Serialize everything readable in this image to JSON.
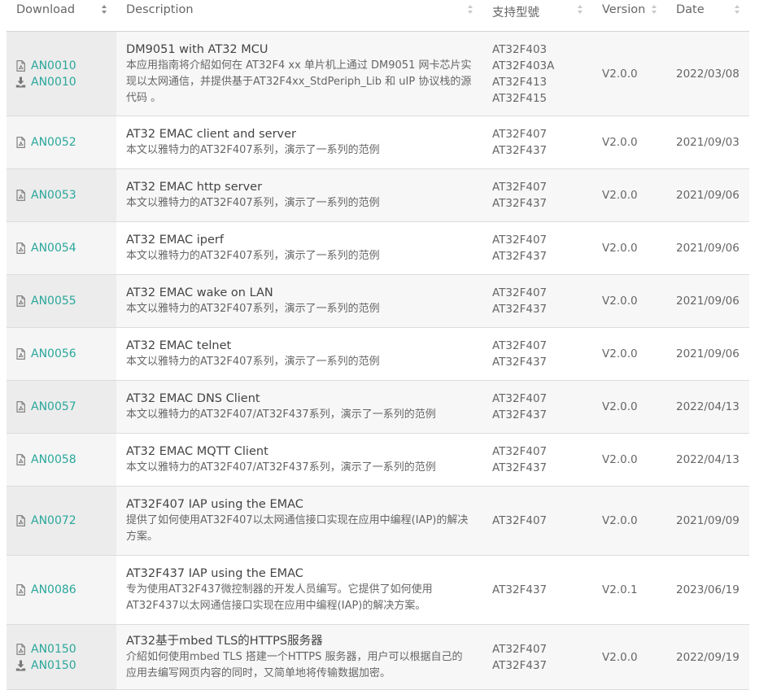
{
  "headers": {
    "download": "Download",
    "description": "Description",
    "models": "支持型號",
    "version": "Version",
    "date": "Date"
  },
  "rows": [
    {
      "downloads": [
        {
          "icon": "pdf-icon",
          "label": "AN0010"
        },
        {
          "icon": "download-icon",
          "label": "AN0010"
        }
      ],
      "title": "DM9051 with AT32 MCU",
      "desc": "本应用指南将介紹如何在 AT32F4 xx 单片机上通过 DM9051 网卡芯片实现以太网通信，并提供基于AT32F4xx_StdPeriph_Lib 和 uIP 协议栈的源代码 。",
      "models": [
        "AT32F403",
        "AT32F403A",
        "AT32F413",
        "AT32F415"
      ],
      "version": "V2.0.0",
      "date": "2022/03/08"
    },
    {
      "downloads": [
        {
          "icon": "pdf-icon",
          "label": "AN0052"
        }
      ],
      "title": "AT32 EMAC client and server",
      "desc": "本文以雅特力的AT32F407系列，演示了一系列的范例",
      "models": [
        "AT32F407",
        "AT32F437"
      ],
      "version": "V2.0.0",
      "date": "2021/09/03"
    },
    {
      "downloads": [
        {
          "icon": "pdf-icon",
          "label": "AN0053"
        }
      ],
      "title": "AT32 EMAC http server",
      "desc": "本文以雅特力的AT32F407系列，演示了一系列的范例",
      "models": [
        "AT32F407",
        "AT32F437"
      ],
      "version": "V2.0.0",
      "date": "2021/09/06"
    },
    {
      "downloads": [
        {
          "icon": "pdf-icon",
          "label": "AN0054"
        }
      ],
      "title": "AT32 EMAC iperf",
      "desc": "本文以雅特力的AT32F407系列，演示了一系列的范例",
      "models": [
        "AT32F407",
        "AT32F437"
      ],
      "version": "V2.0.0",
      "date": "2021/09/06"
    },
    {
      "downloads": [
        {
          "icon": "pdf-icon",
          "label": "AN0055"
        }
      ],
      "title": "AT32 EMAC wake on LAN",
      "desc": "本文以雅特力的AT32F407系列，演示了一系列的范例",
      "models": [
        "AT32F407",
        "AT32F437"
      ],
      "version": "V2.0.0",
      "date": "2021/09/06"
    },
    {
      "downloads": [
        {
          "icon": "pdf-icon",
          "label": "AN0056"
        }
      ],
      "title": "AT32 EMAC telnet",
      "desc": "本文以雅特力的AT32F407系列，演示了一系列的范例",
      "models": [
        "AT32F407",
        "AT32F437"
      ],
      "version": "V2.0.0",
      "date": "2021/09/06"
    },
    {
      "downloads": [
        {
          "icon": "pdf-icon",
          "label": "AN0057"
        }
      ],
      "title": "AT32 EMAC DNS Client",
      "desc": "本文以雅特力的AT32F407/AT32F437系列，演示了一系列的范例",
      "models": [
        "AT32F407",
        "AT32F437"
      ],
      "version": "V2.0.0",
      "date": "2022/04/13"
    },
    {
      "downloads": [
        {
          "icon": "pdf-icon",
          "label": "AN0058"
        }
      ],
      "title": "AT32 EMAC MQTT Client",
      "desc": "本文以雅特力的AT32F407/AT32F437系列，演示了一系列的范例",
      "models": [
        "AT32F407",
        "AT32F437"
      ],
      "version": "V2.0.0",
      "date": "2022/04/13"
    },
    {
      "downloads": [
        {
          "icon": "pdf-icon",
          "label": "AN0072"
        }
      ],
      "title": "AT32F407 IAP using the EMAC",
      "desc": "提供了如何使用AT32F407以太网通信接口实现在应用中编程(IAP)的解决方案。",
      "models": [
        "AT32F407"
      ],
      "version": "V2.0.0",
      "date": "2021/09/09"
    },
    {
      "downloads": [
        {
          "icon": "pdf-icon",
          "label": "AN0086"
        }
      ],
      "title": "AT32F437 IAP using the EMAC",
      "desc": "专为使用AT32F437微控制器的开发人员编写。它提供了如何使用AT32F437以太网通信接口实现在应用中编程(IAP)的解决方案。",
      "models": [
        "AT32F437"
      ],
      "version": "V2.0.1",
      "date": "2023/06/19"
    },
    {
      "downloads": [
        {
          "icon": "pdf-icon",
          "label": "AN0150"
        },
        {
          "icon": "download-icon",
          "label": "AN0150"
        }
      ],
      "title": "AT32基于mbed TLS的HTTPS服务器",
      "desc": "介紹如何使用mbed TLS 搭建一个HTTPS 服务器，用户可以根据自己的应用去编写网页内容的同时，又简单地将传输数据加密。",
      "models": [
        "AT32F407",
        "AT32F437"
      ],
      "version": "V2.0.0",
      "date": "2022/09/19"
    }
  ]
}
